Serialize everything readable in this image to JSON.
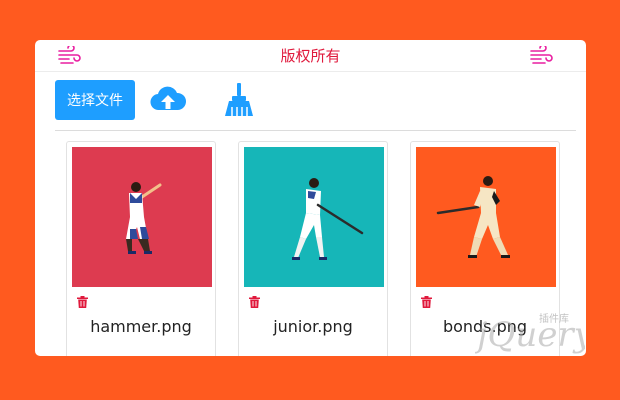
{
  "header": {
    "title": "版权所有",
    "left_icon": "wind-icon",
    "right_icon": "wind-icon",
    "title_color": "#e0193c",
    "icon_color": "#e91ea0"
  },
  "toolbar": {
    "select_label": "选择文件",
    "upload_icon": "cloud-upload-icon",
    "clear_icon": "broom-icon",
    "accent": "#1e9eff"
  },
  "files": [
    {
      "name": "hammer.png",
      "background": "#dd3b50",
      "delete_icon": "trash-icon"
    },
    {
      "name": "junior.png",
      "background": "#16b6b8",
      "delete_icon": "trash-icon"
    },
    {
      "name": "bonds.png",
      "background": "#ff5a1f",
      "delete_icon": "trash-icon"
    }
  ],
  "watermark": {
    "text": "jQuery",
    "subtext": "插件库"
  },
  "page": {
    "background": "#ff5a1f"
  }
}
